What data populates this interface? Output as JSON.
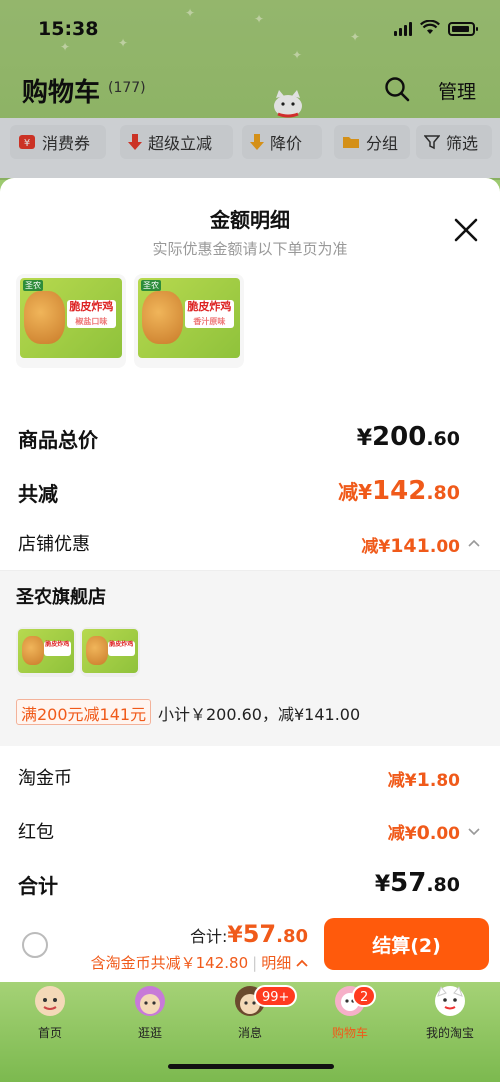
{
  "status_bar": {
    "time": "15:38"
  },
  "header": {
    "title": "购物车",
    "count": "(177)",
    "manage_label": "管理"
  },
  "chips": [
    {
      "label": "消费券",
      "icon": "coupon-icon"
    },
    {
      "label": "超级立减",
      "icon": "down-arrow-icon"
    },
    {
      "label": "降价",
      "icon": "price-drop-icon"
    },
    {
      "label": "分组",
      "icon": "folder-icon"
    },
    {
      "label": "筛选",
      "icon": "filter-icon"
    }
  ],
  "sheet": {
    "title": "金额明细",
    "subtitle": "实际优惠金额请以下单页为准",
    "products": [
      {
        "name": "脆皮炸鸡",
        "flavor": "椒盐口味"
      },
      {
        "name": "脆皮炸鸡",
        "flavor": "香汁原味"
      }
    ],
    "goods_total": {
      "label": "商品总价",
      "currency": "¥",
      "int": "200",
      "dec": ".60"
    },
    "total_reduce": {
      "label": "共减",
      "prefix": "减¥",
      "int": "142",
      "dec": ".80"
    },
    "store_discount": {
      "label": "店铺优惠",
      "prefix": "减¥",
      "int": "141",
      "dec": ".00"
    },
    "shop": {
      "name": "圣农旗舰店",
      "promo_tag": "满200元减141元",
      "promo_text": "小计￥200.60，减¥141.00"
    },
    "taojinbi": {
      "label": "淘金币",
      "prefix": "减¥",
      "int": "1",
      "dec": ".80"
    },
    "hongbao": {
      "label": "红包",
      "prefix": "减¥",
      "int": "0",
      "dec": ".00"
    },
    "sum": {
      "label": "合计",
      "currency": "¥",
      "int": "57",
      "dec": ".80"
    }
  },
  "checkout": {
    "total_label": "合计:",
    "total_currency": "¥",
    "total_int": "57",
    "total_dec": ".80",
    "subline": "含淘金币共减￥142.80",
    "detail_label": "明细",
    "pay_label": "结算(2)"
  },
  "tabs": [
    {
      "label": "首页"
    },
    {
      "label": "逛逛"
    },
    {
      "label": "消息",
      "badge": "99+"
    },
    {
      "label": "购物车",
      "badge": "2"
    },
    {
      "label": "我的淘宝"
    }
  ],
  "colors": {
    "accent": "#ff5a0c",
    "price": "#f05a1a",
    "tab_bg": "#8fc46a"
  }
}
